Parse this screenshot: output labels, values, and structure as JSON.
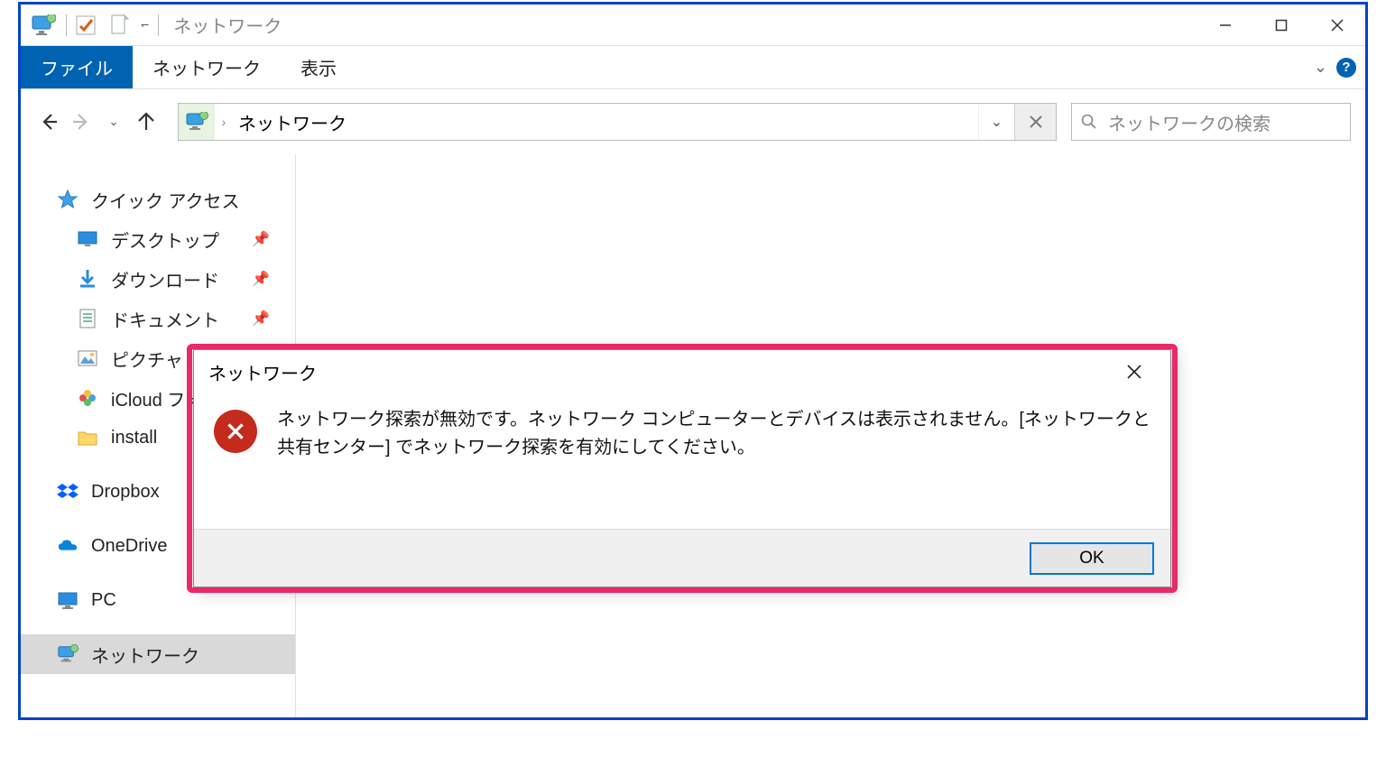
{
  "window": {
    "title": "ネットワーク"
  },
  "ribbon": {
    "file": "ファイル",
    "tabs": [
      "ネットワーク",
      "表示"
    ]
  },
  "address": {
    "location": "ネットワーク"
  },
  "search": {
    "placeholder": "ネットワークの検索"
  },
  "sidebar": {
    "quick_access": "クイック アクセス",
    "items": [
      {
        "label": "デスクトップ",
        "icon": "desktop",
        "pinned": true
      },
      {
        "label": "ダウンロード",
        "icon": "download",
        "pinned": true
      },
      {
        "label": "ドキュメント",
        "icon": "document",
        "pinned": true
      },
      {
        "label": "ピクチャ",
        "icon": "pictures",
        "pinned": true
      },
      {
        "label": "iCloud フォト",
        "icon": "icloud",
        "pinned": false
      },
      {
        "label": "install",
        "icon": "folder",
        "pinned": false
      }
    ],
    "dropbox": "Dropbox",
    "onedrive": "OneDrive",
    "pc": "PC",
    "network": "ネットワーク"
  },
  "dialog": {
    "title": "ネットワーク",
    "message": "ネットワーク探索が無効です。ネットワーク コンピューターとデバイスは表示されません。[ネットワークと共有センター] でネットワーク探索を有効にしてください。",
    "ok": "OK"
  }
}
